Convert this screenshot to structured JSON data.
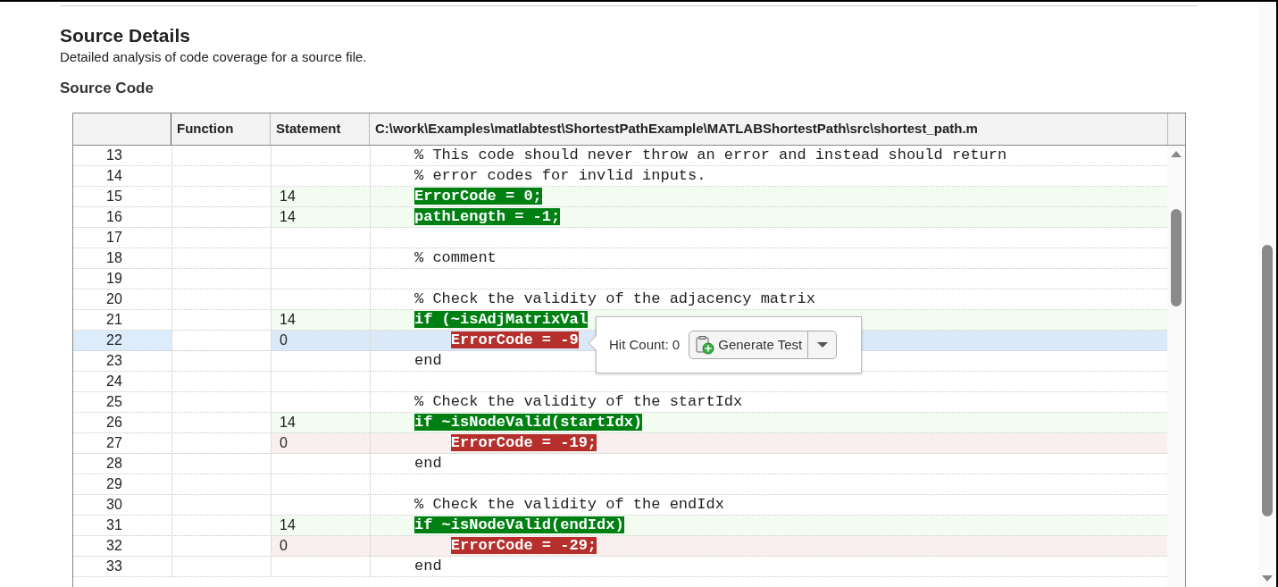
{
  "section": {
    "title": "Source Details",
    "description": "Detailed analysis of code coverage for a source file.",
    "subtitle": "Source Code"
  },
  "table": {
    "columns": [
      "Function",
      "Statement",
      "C:\\work\\Examples\\matlabtest\\ShortestPathExample\\MATLABShortestPath\\src\\shortest_path.m"
    ],
    "rows": [
      {
        "line": "13",
        "count": "",
        "kind": "plain",
        "code": "% This code should never throw an error and instead should return",
        "selected": false
      },
      {
        "line": "14",
        "count": "",
        "kind": "plain",
        "code": "% error codes for invlid inputs.",
        "selected": false
      },
      {
        "line": "15",
        "count": "14",
        "kind": "covered",
        "code": "ErrorCode = 0;",
        "selected": false
      },
      {
        "line": "16",
        "count": "14",
        "kind": "covered",
        "code": "pathLength = -1;",
        "selected": false
      },
      {
        "line": "17",
        "count": "",
        "kind": "plain",
        "code": "",
        "selected": false
      },
      {
        "line": "18",
        "count": "",
        "kind": "plain",
        "code": "% comment",
        "selected": false
      },
      {
        "line": "19",
        "count": "",
        "kind": "plain",
        "code": "",
        "selected": false
      },
      {
        "line": "20",
        "count": "",
        "kind": "plain",
        "code": "% Check the validity of the adjacency matrix",
        "selected": false
      },
      {
        "line": "21",
        "count": "14",
        "kind": "covered",
        "code": "if (~isAdjMatrixVal",
        "selected": false
      },
      {
        "line": "22",
        "count": "0",
        "kind": "uncovered",
        "code": "    ErrorCode = -9",
        "selected": true
      },
      {
        "line": "23",
        "count": "",
        "kind": "plain",
        "code": "end",
        "selected": false
      },
      {
        "line": "24",
        "count": "",
        "kind": "plain",
        "code": "",
        "selected": false
      },
      {
        "line": "25",
        "count": "",
        "kind": "plain",
        "code": "% Check the validity of the startIdx",
        "selected": false
      },
      {
        "line": "26",
        "count": "14",
        "kind": "covered",
        "code": "if ~isNodeValid(startIdx)",
        "selected": false
      },
      {
        "line": "27",
        "count": "0",
        "kind": "uncovered",
        "code": "    ErrorCode = -19;",
        "selected": false
      },
      {
        "line": "28",
        "count": "",
        "kind": "plain",
        "code": "end",
        "selected": false
      },
      {
        "line": "29",
        "count": "",
        "kind": "plain",
        "code": "",
        "selected": false
      },
      {
        "line": "30",
        "count": "",
        "kind": "plain",
        "code": "% Check the validity of the endIdx",
        "selected": false
      },
      {
        "line": "31",
        "count": "14",
        "kind": "covered",
        "code": "if ~isNodeValid(endIdx)",
        "selected": false
      },
      {
        "line": "32",
        "count": "0",
        "kind": "uncovered",
        "code": "    ErrorCode = -29;",
        "selected": false
      },
      {
        "line": "33",
        "count": "",
        "kind": "plain",
        "code": "end",
        "selected": false
      }
    ]
  },
  "popup": {
    "label": "Hit Count: 0",
    "button": "Generate Test"
  }
}
